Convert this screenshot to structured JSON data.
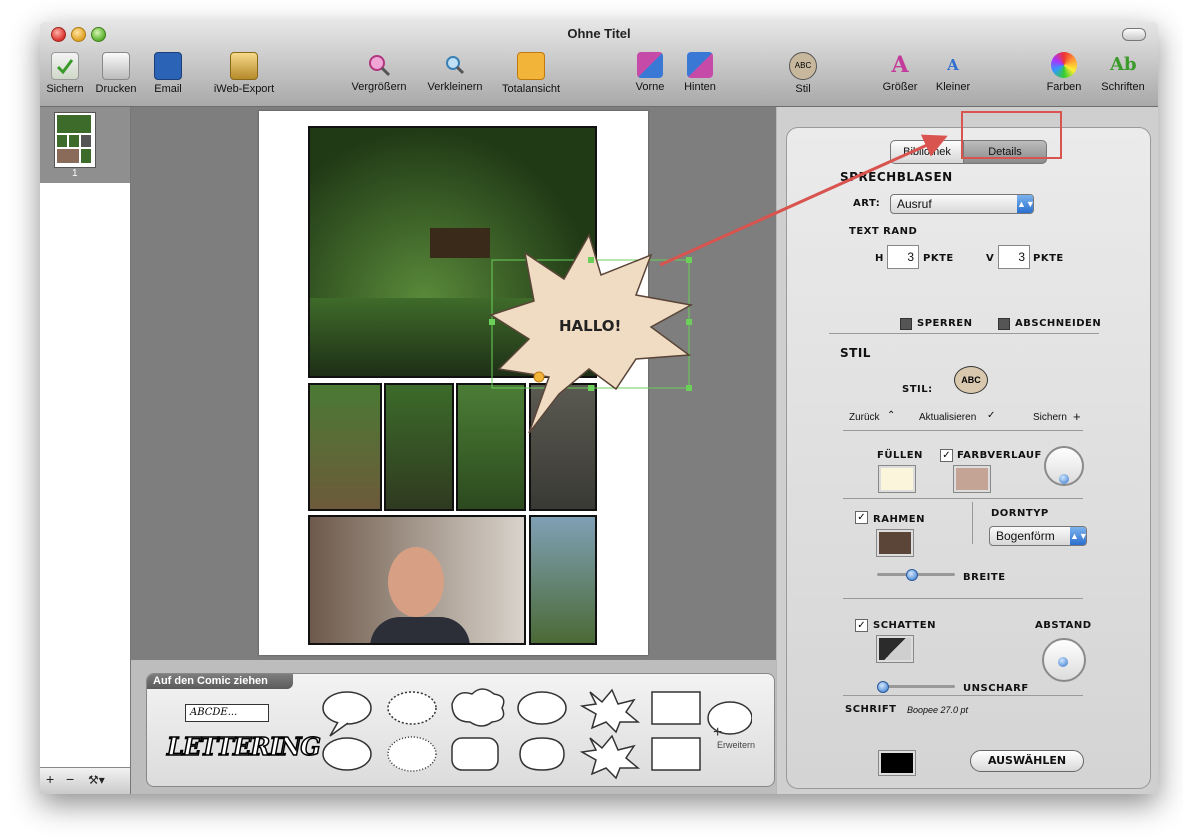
{
  "window": {
    "title": "Ohne Titel"
  },
  "toolbar": {
    "items": [
      {
        "label": "Sichern",
        "icon": "save-icon"
      },
      {
        "label": "Drucken",
        "icon": "print-icon"
      },
      {
        "label": "Email",
        "icon": "email-icon"
      },
      {
        "label": "iWeb-Export",
        "icon": "iweb-export-icon"
      },
      {
        "label": "Vergrößern",
        "icon": "zoom-in-icon"
      },
      {
        "label": "Verkleinern",
        "icon": "zoom-out-icon"
      },
      {
        "label": "Totalansicht",
        "icon": "fit-view-icon"
      },
      {
        "label": "Vorne",
        "icon": "bring-front-icon"
      },
      {
        "label": "Hinten",
        "icon": "send-back-icon"
      },
      {
        "label": "Stil",
        "icon": "style-bubble-icon"
      },
      {
        "label": "Größer",
        "icon": "text-bigger-icon"
      },
      {
        "label": "Kleiner",
        "icon": "text-smaller-icon"
      },
      {
        "label": "Farben",
        "icon": "color-wheel-icon"
      },
      {
        "label": "Schriften",
        "icon": "fonts-icon"
      }
    ]
  },
  "sidebar": {
    "page_number": "1",
    "add": "+",
    "remove": "−",
    "action": "⚒▾"
  },
  "canvas": {
    "bubble_text": "HALLO!"
  },
  "bubble_library": {
    "tab_label": "Auf den Comic ziehen",
    "text_sample": "ABCDE...",
    "lettering": "LETTERING",
    "expand_label": "Erweitern"
  },
  "inspector": {
    "tabs": {
      "library": "Bibliothek",
      "details": "Details"
    },
    "speech_bubbles_heading": "SPRECHBLASEN",
    "type_label": "ART:",
    "type_value": "Ausruf",
    "text_margin_label": "TEXT RAND",
    "h_label": "H",
    "h_value": "3",
    "v_label": "V",
    "v_value": "3",
    "unit": "PKTE",
    "lock_label": "SPERREN",
    "clip_label": "ABSCHNEIDEN",
    "style_heading": "STIL",
    "style_label": "STIL:",
    "back_label": "Zurück",
    "update_label": "Aktualisieren",
    "save_label": "Sichern",
    "fill_label": "FÜLLEN",
    "gradient_label": "FARBVERLAUF",
    "border_label": "RAHMEN",
    "spike_label": "DORNTYP",
    "spike_value": "Bogenförm",
    "width_label": "BREITE",
    "shadow_label": "SCHATTEN",
    "distance_label": "ABSTAND",
    "blur_label": "UNSCHARF",
    "font_label": "SCHRIFT",
    "font_value": "Boopee 27.0 pt",
    "choose_button": "AUSWÄHLEN",
    "colors": {
      "fill": "#fbf5dc",
      "gradient": "#c4a494",
      "border": "#5a4538",
      "shadow_dark": "#2b2b2b",
      "font": "#000000"
    },
    "gradient_checked": true,
    "border_checked": true,
    "shadow_checked": true
  }
}
